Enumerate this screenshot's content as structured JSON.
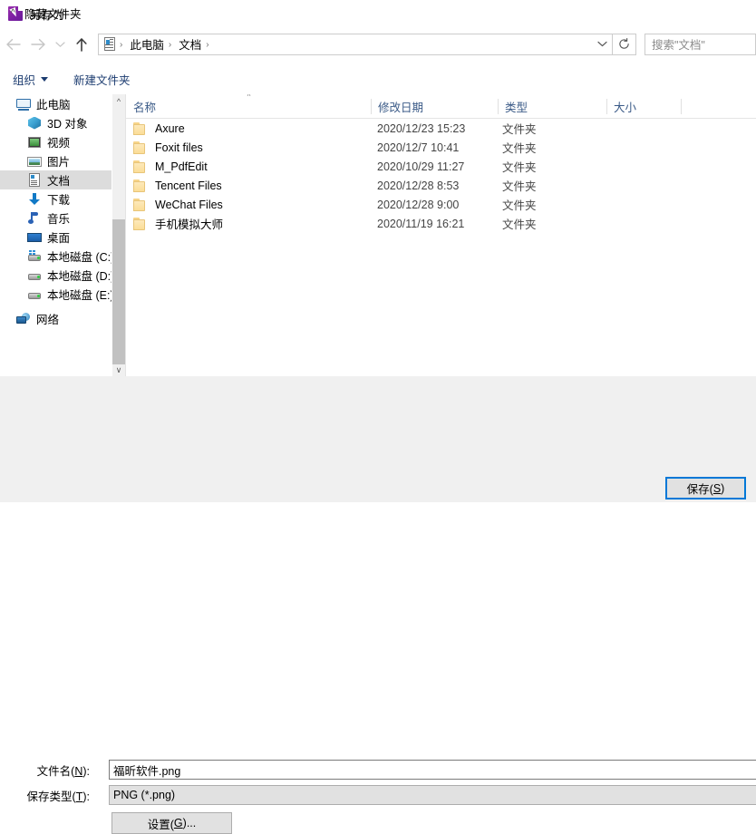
{
  "window": {
    "title": "另存为",
    "icon": "save-as-icon"
  },
  "nav": {
    "back_icon": "arrow-left-icon",
    "forward_icon": "arrow-right-icon",
    "recent_icon": "chevron-down-icon",
    "up_icon": "arrow-up-icon",
    "address_icon": "documents-icon",
    "breadcrumbs": [
      "此电脑",
      "文档"
    ],
    "separator": "›",
    "dropdown_icon": "chevron-down-icon",
    "refresh_icon": "refresh-icon",
    "search_placeholder": "搜索\"文档\""
  },
  "command_bar": {
    "organize": "组织",
    "new_folder": "新建文件夹"
  },
  "sidebar": {
    "items": [
      {
        "label": "此电脑",
        "icon": "computer-icon",
        "level": 0,
        "selected": false
      },
      {
        "label": "3D 对象",
        "icon": "3d-objects-icon",
        "level": 1,
        "selected": false
      },
      {
        "label": "视频",
        "icon": "videos-icon",
        "level": 1,
        "selected": false
      },
      {
        "label": "图片",
        "icon": "pictures-icon",
        "level": 1,
        "selected": false
      },
      {
        "label": "文档",
        "icon": "documents-icon",
        "level": 1,
        "selected": true
      },
      {
        "label": "下载",
        "icon": "downloads-icon",
        "level": 1,
        "selected": false
      },
      {
        "label": "音乐",
        "icon": "music-icon",
        "level": 1,
        "selected": false
      },
      {
        "label": "桌面",
        "icon": "desktop-icon",
        "level": 1,
        "selected": false
      },
      {
        "label": "本地磁盘 (C:)",
        "icon": "system-drive-icon",
        "level": 1,
        "selected": false
      },
      {
        "label": "本地磁盘 (D:)",
        "icon": "drive-icon",
        "level": 1,
        "selected": false
      },
      {
        "label": "本地磁盘 (E:)",
        "icon": "drive-icon",
        "level": 1,
        "selected": false
      },
      {
        "label": "网络",
        "icon": "network-icon",
        "level": 0,
        "selected": false
      }
    ],
    "scroll_up_icon": "chevron-up-icon",
    "scroll_down_icon": "chevron-down-icon"
  },
  "file_list": {
    "columns": [
      {
        "label": "名称",
        "sorted": true,
        "sort_direction": "asc"
      },
      {
        "label": "修改日期",
        "sorted": false
      },
      {
        "label": "类型",
        "sorted": false
      },
      {
        "label": "大小",
        "sorted": false
      }
    ],
    "rows": [
      {
        "name": "Axure",
        "modified": "2020/12/23 15:23",
        "type": "文件夹",
        "size": "",
        "icon": "folder-icon"
      },
      {
        "name": "Foxit files",
        "modified": "2020/12/7 10:41",
        "type": "文件夹",
        "size": "",
        "icon": "folder-icon"
      },
      {
        "name": "M_PdfEdit",
        "modified": "2020/10/29 11:27",
        "type": "文件夹",
        "size": "",
        "icon": "folder-icon"
      },
      {
        "name": "Tencent Files",
        "modified": "2020/12/28 8:53",
        "type": "文件夹",
        "size": "",
        "icon": "folder-icon"
      },
      {
        "name": "WeChat Files",
        "modified": "2020/12/28 9:00",
        "type": "文件夹",
        "size": "",
        "icon": "folder-icon"
      },
      {
        "name": "手机模拟大师",
        "modified": "2020/11/19 16:21",
        "type": "文件夹",
        "size": "",
        "icon": "folder-icon"
      }
    ]
  },
  "form": {
    "filename_label_pre": "文件名(",
    "filename_label_key": "N",
    "filename_label_post": "):",
    "filename_value": "福昕软件.png",
    "filetype_label_pre": "保存类型(",
    "filetype_label_key": "T",
    "filetype_label_post": "):",
    "filetype_value": "PNG (*.png)",
    "settings_pre": "设置(",
    "settings_key": "G",
    "settings_post": ")..."
  },
  "footer": {
    "hide_folders": "隐藏文件夹",
    "hide_folders_icon": "chevron-up-icon",
    "save_pre": "保存(",
    "save_key": "S",
    "save_post": ")"
  },
  "colors": {
    "accent": "#0078d7",
    "selection": "#dcdcdc",
    "chrome": "#f0f0f0",
    "link": "#1c3c70"
  }
}
